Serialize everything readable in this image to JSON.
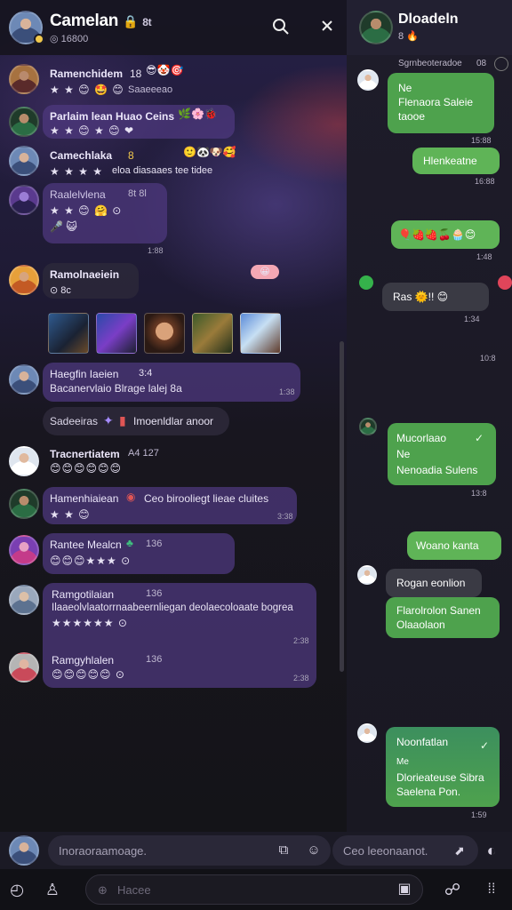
{
  "left": {
    "header": {
      "title": "Camelan",
      "title_badge": "🔒",
      "title_extra": "8t",
      "subtitle_icon": "◎",
      "subtitle": "16800",
      "icons": [
        "search-icon",
        "close-icon"
      ]
    },
    "messages": [
      {
        "name": "Ramenchidem",
        "meta": "18",
        "reactions": "😎🤡🎯",
        "line": "★ ★ 😊 🤩 😊",
        "extra": "Saaeeeao",
        "time": ""
      },
      {
        "name": "Parlaim lean Huao Ceins",
        "meta": "",
        "reactions": "🌿🌸🐞",
        "line": "★ ★ 😊 ★ 😊 ❤",
        "extra": "",
        "time": ""
      },
      {
        "name": "Camechlaka",
        "meta": "8",
        "reactions": "🙂🐼🐶🥰",
        "line": "★ ★ ★ ★",
        "extra": "eloa diasaaes tee tidee",
        "time": ""
      },
      {
        "name": "Raalelvlena",
        "meta": "8t  8l",
        "reactions": "",
        "line": "★ ★ 😊 🤗 ⊙",
        "extra": "🎤 😺",
        "time": "1:88"
      },
      {
        "name": "Ramolnaeiein",
        "meta": "",
        "reactions": "😀",
        "line": "⊙ 8c",
        "extra": "",
        "time": ""
      },
      {
        "name": "Haegfin Iaeien",
        "meta": "3:4",
        "reactions": "",
        "line": "Bacanervlaio Blrage lalej 8a",
        "extra": "",
        "time": "1:38"
      },
      {
        "name": "Tracnertiatem",
        "meta": "A4  127",
        "reactions": "",
        "line": "😊😊😊😊😊😊",
        "extra": "",
        "time": ""
      },
      {
        "name": "Hamenhiaiean",
        "meta": "",
        "reactions": "",
        "line": "★ ★ 😊",
        "extra": "Ceo birooliegt lieae cluites",
        "time": "3:38"
      },
      {
        "name": "Rantee Mealcn",
        "meta": "136",
        "reactions": "",
        "line": "😊😊😊★★★ ⊙",
        "extra": "",
        "time": ""
      },
      {
        "name": "Ramgotilaian",
        "meta": "136",
        "reactions": "",
        "line": "Ilaaeolvlaatorrnaabeernliegan deolaecoloaate bogrea",
        "extra": "★★★★★★ ⊙",
        "time": "2:38"
      },
      {
        "name": "Ramgyhlalen",
        "meta": "136",
        "reactions": "",
        "line": "😊😊😊😊😊 ⊙",
        "extra": "",
        "time": "2:38"
      }
    ],
    "system": {
      "label": "Sadeeiras",
      "text": "Imoenldlar anoor"
    },
    "timestamps": [
      "1:88",
      "1:38",
      "3:38",
      "2:38",
      "2:38"
    ]
  },
  "right": {
    "header": {
      "title": "Dloadeln",
      "sub_badge": "8",
      "sub_icon": "🔥"
    },
    "top_caption": "Sgrnbeoteradoe",
    "top_caption_time": "08",
    "bubbles": [
      {
        "lines": [
          "Ne",
          "Flenaora Saleie",
          "taooe"
        ],
        "time": "15:88"
      },
      {
        "lines": [
          "Hlenkeatne"
        ],
        "time": "16:88"
      },
      {
        "lines": [
          "🎈🍓🍓🍒🧁😊"
        ],
        "time": "1:48"
      },
      {
        "lines": [
          "Ras 🌞!! 😊"
        ],
        "time": "1:34"
      },
      {
        "lines": [
          "Mucorlaao",
          "Ne",
          "Nenoadia Sulens"
        ],
        "time": "13:8"
      },
      {
        "lines": [
          "Woano kanta"
        ],
        "time": ""
      },
      {
        "lines": [
          "Rogan eonlion"
        ],
        "time": ""
      },
      {
        "lines": [
          "Flarolrolon Sanen",
          "Olaaolaon"
        ],
        "time": ""
      },
      {
        "lines": [
          "Noonfatlan",
          "Me",
          "Dlorieateuse Sibra",
          "Saelena Pon."
        ],
        "time": "1:59"
      }
    ],
    "time_extra": "10:8"
  },
  "composer": {
    "placeholder": "Inoraoraamoage.",
    "placeholder2": "Ceo leeonaanot."
  },
  "bottom": {
    "search_placeholder": "Hacee"
  }
}
